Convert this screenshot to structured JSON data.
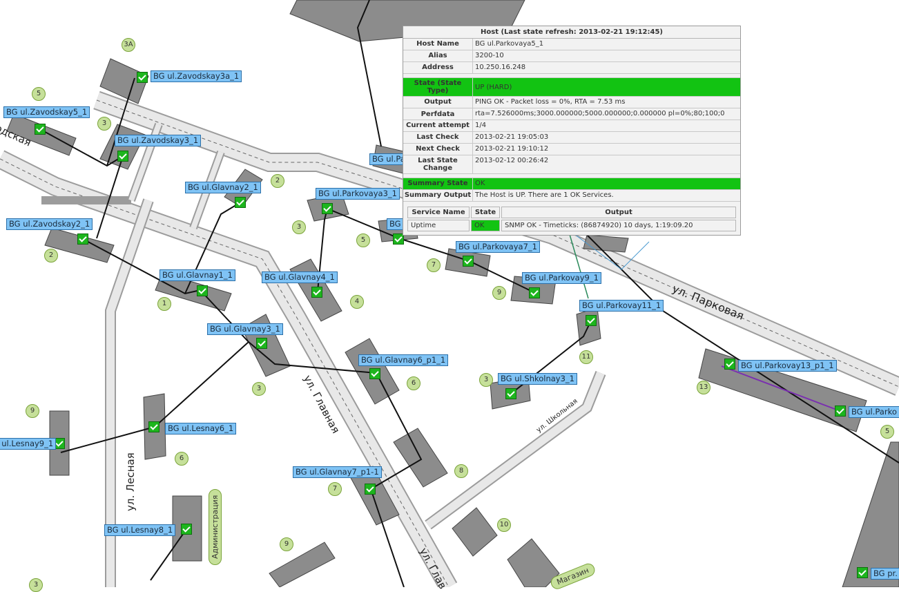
{
  "map": {
    "streets": {
      "parkovaya": "ул. Парковая",
      "glavnaya_1": "ул. Главная",
      "glavnaya_2": "ул. Глав",
      "lesnaya": "ул. Лесная",
      "shkolnaya": "ул. Школьная",
      "zavodskaya": "одская"
    },
    "pills": {
      "administration": "Администрация",
      "shop": "Магазин"
    },
    "numbers": [
      "3А",
      "5",
      "3",
      "2",
      "1",
      "9",
      "6",
      "3",
      "4",
      "5",
      "7",
      "9",
      "11",
      "3",
      "6",
      "8",
      "7",
      "10",
      "13",
      "9",
      "3",
      "5",
      "2",
      "3"
    ],
    "hosts": [
      "BG ul.Zavodskay3a_1",
      "BG ul.Zavodskay5_1",
      "BG ul.Zavodskay3_1",
      "BG ul.Zavodskay2_1",
      "BG ul.Glavnay2_1",
      "BG ul.Glavnay1_1",
      "BG ul.Glavnay3_1",
      "BG ul.Glavnay4_1",
      "BG ul.Glavnay6_p1_1",
      "BG ul.Glavnay7_p1-1",
      "BG ul.Lesnay6_1",
      "BG ul.Lesnay9_1",
      "BG ul.Lesnay8_1",
      "BG ul.Parkovaya3_1",
      "BG ul.Parkovaya7_1",
      "BG ul.Parkovay9_1",
      "BG ul.Parkovay11_1",
      "BG ul.Shkolnay3_1",
      "BG ul.Parkovay13_p1_1",
      "BG ul.Parko",
      "BG ul.Pa",
      "BG",
      "BG pr."
    ]
  },
  "popup": {
    "title": "Host (Last state refresh: 2013-02-21 19:12:45)",
    "rows": [
      {
        "k": "Host Name",
        "v": "BG ul.Parkovaya5_1"
      },
      {
        "k": "Alias",
        "v": "3200-10"
      },
      {
        "k": "Address",
        "v": "10.250.16.248"
      },
      {
        "k": "State (State Type)",
        "v": "UP (HARD)"
      },
      {
        "k": "Output",
        "v": "PING OK - Packet loss = 0%, RTA = 7.53 ms"
      },
      {
        "k": "Perfdata",
        "v": "rta=7.526000ms;3000.000000;5000.000000;0.000000 pl=0%;80;100;0"
      },
      {
        "k": "Current attempt",
        "v": "1/4"
      },
      {
        "k": "Last Check",
        "v": "2013-02-21 19:05:03"
      },
      {
        "k": "Next Check",
        "v": "2013-02-21 19:10:12"
      },
      {
        "k": "Last State Change",
        "v": "2013-02-12 00:26:42"
      },
      {
        "k": "Summary State",
        "v": "OK"
      },
      {
        "k": "Summary Output",
        "v": "The Host is UP. There are 1 OK Services."
      }
    ],
    "services": {
      "headers": [
        "Service Name",
        "State",
        "Output"
      ],
      "rows": [
        {
          "name": "Uptime",
          "state": "OK",
          "output": "SNMP OK - Timeticks: (86874920) 10 days, 1:19:09.20"
        }
      ]
    }
  },
  "colors": {
    "label_bg": "#7fc3f5",
    "ok_green": "#12c312",
    "building": "#8a8a8a"
  }
}
